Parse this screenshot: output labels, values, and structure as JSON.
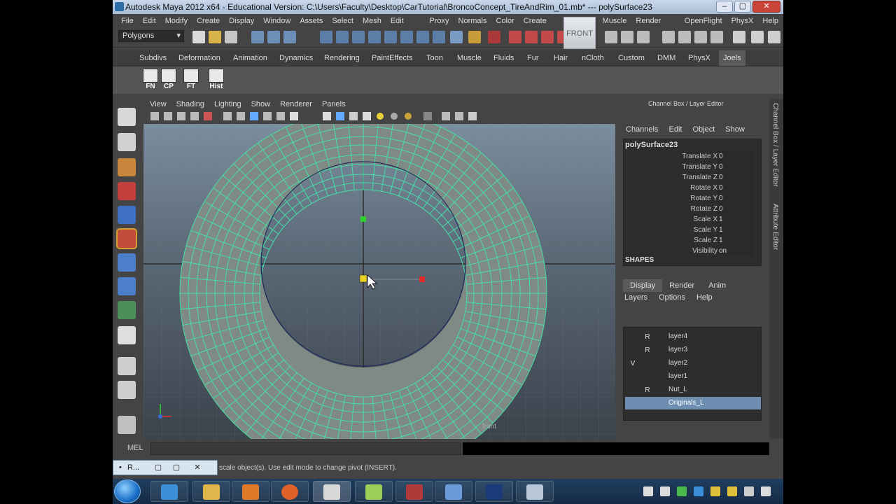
{
  "window": {
    "title": "Autodesk Maya 2012 x64 - Educational Version: C:\\Users\\Faculty\\Desktop\\CarTutorial\\BroncoConcept_TireAndRim_01.mb*   ---   polySurface23",
    "min": "–",
    "max": "▢",
    "close": "✕"
  },
  "menus": [
    "File",
    "Edit",
    "Modify",
    "Create",
    "Display",
    "Window",
    "Assets",
    "Select",
    "Mesh",
    "Edit Mesh",
    "Proxy",
    "Normals",
    "Color",
    "Create UVs",
    "Edit UVs",
    "Muscle",
    "Render Farm",
    "OpenFlight",
    "PhysX",
    "Help"
  ],
  "status": {
    "mode": "Polygons"
  },
  "shelf_tabs": [
    "Subdivs",
    "Deformation",
    "Animation",
    "Dynamics",
    "Rendering",
    "PaintEffects",
    "Toon",
    "Muscle",
    "Fluids",
    "Fur",
    "Hair",
    "nCloth",
    "Custom",
    "DMM",
    "PhysX",
    "Joels"
  ],
  "shelf_buttons": [
    "FN",
    "CP",
    "FT",
    "Hist"
  ],
  "viewport": {
    "menus": [
      "View",
      "Shading",
      "Lighting",
      "Show",
      "Renderer",
      "Panels"
    ],
    "cube_label": "FRONT",
    "camera_label": "front"
  },
  "channel_box": {
    "header": "Channel Box / Layer Editor",
    "menus": [
      "Channels",
      "Edit",
      "Object",
      "Show"
    ],
    "object": "polySurface23",
    "attributes": [
      {
        "name": "Translate X",
        "value": "0"
      },
      {
        "name": "Translate Y",
        "value": "0"
      },
      {
        "name": "Translate Z",
        "value": "0"
      },
      {
        "name": "Rotate X",
        "value": "0"
      },
      {
        "name": "Rotate Y",
        "value": "0"
      },
      {
        "name": "Rotate Z",
        "value": "0"
      },
      {
        "name": "Scale X",
        "value": "1"
      },
      {
        "name": "Scale Y",
        "value": "1"
      },
      {
        "name": "Scale Z",
        "value": "1"
      },
      {
        "name": "Visibility",
        "value": "on"
      }
    ],
    "shapes_label": "SHAPES"
  },
  "layer_editor": {
    "tabs": [
      "Display",
      "Render",
      "Anim"
    ],
    "menus": [
      "Layers",
      "Options",
      "Help"
    ],
    "layers": [
      {
        "name": "layer4",
        "vis": "",
        "ref": "R"
      },
      {
        "name": "layer3",
        "vis": "",
        "ref": "R"
      },
      {
        "name": "layer2",
        "vis": "V",
        "ref": ""
      },
      {
        "name": "layer1",
        "vis": "",
        "ref": ""
      },
      {
        "name": "Nut_L",
        "vis": "",
        "ref": "R"
      },
      {
        "name": "Originals_L",
        "vis": "",
        "ref": ""
      }
    ]
  },
  "side_tabs": [
    "Channel Box / Layer Editor",
    "Attribute Editor"
  ],
  "command_line": {
    "label": "MEL"
  },
  "help_line": {
    "text": "scale object(s). Use edit mode to change pivot (INSERT)."
  },
  "minimized_window": {
    "label": "R..."
  }
}
